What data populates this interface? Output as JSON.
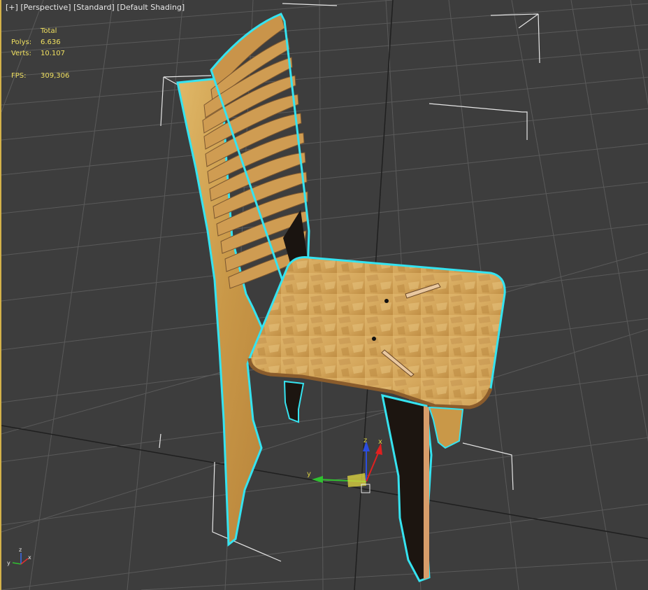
{
  "viewport": {
    "labels": {
      "plus": "[+]",
      "view": "[Perspective]",
      "mode": "[Standard]",
      "shading": "[Default Shading]"
    },
    "stats": {
      "header": "Total",
      "polys_label": "Polys:",
      "polys_value": "6.636",
      "verts_label": "Verts:",
      "verts_value": "10.107",
      "fps_label": "FPS:",
      "fps_value": "309,306"
    },
    "gizmo": {
      "x": "x",
      "y": "y",
      "z": "z"
    },
    "corner_axes": {
      "x": "x",
      "y": "y",
      "z": "z"
    }
  },
  "colors": {
    "background": "#3d3d3d",
    "grid": "#5a5a5a",
    "grid_major": "#1f1f1f",
    "selection_outline": "#35e3f0",
    "bounding_box": "#e6e6e6",
    "wood": "#d6a85a",
    "stats_text": "#f0e060",
    "viewport_border": "#d4b24a"
  },
  "icons": {
    "transform_gizmo": "move-gizmo-icon",
    "world_axes": "axis-tripod-icon"
  }
}
